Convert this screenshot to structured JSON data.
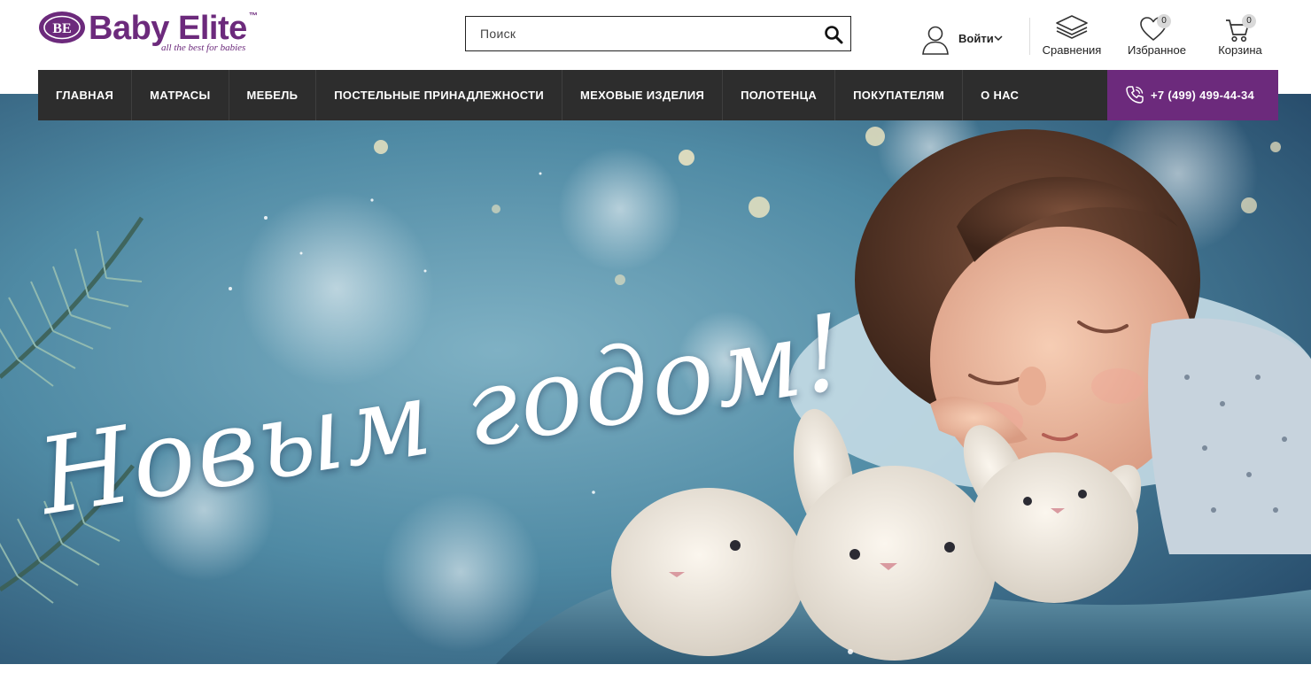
{
  "brand": {
    "name": "Baby Elite",
    "badge": "BE",
    "trademark": "™",
    "tagline": "all the best for babies",
    "color": "#6c2a7c"
  },
  "search": {
    "placeholder": "Поиск",
    "icon": "search-icon"
  },
  "account": {
    "login_label": "Войти",
    "icon": "user-icon"
  },
  "header_actions": {
    "compare": {
      "label": "Сравнения",
      "icon": "layers-icon"
    },
    "wishlist": {
      "label": "Избранное",
      "icon": "heart-icon",
      "count": "0"
    },
    "cart": {
      "label": "Корзина",
      "icon": "cart-icon",
      "count": "0"
    }
  },
  "nav": {
    "items": [
      {
        "label": "ГЛАВНАЯ"
      },
      {
        "label": "МАТРАСЫ"
      },
      {
        "label": "МЕБЕЛЬ"
      },
      {
        "label": "ПОСТЕЛЬНЫЕ ПРИНАДЛЕЖНОСТИ"
      },
      {
        "label": "МЕХОВЫЕ ИЗДЕЛИЯ"
      },
      {
        "label": "ПОЛОТЕНЦА"
      },
      {
        "label": "ПОКУПАТЕЛЯМ"
      },
      {
        "label": "О НАС"
      }
    ],
    "phone": "+7 (499) 499-44-34",
    "phone_icon": "phone-icon",
    "background": "#2d2d2d",
    "accent": "#6c2a7c"
  },
  "banner": {
    "headline": "Новым годом!"
  }
}
